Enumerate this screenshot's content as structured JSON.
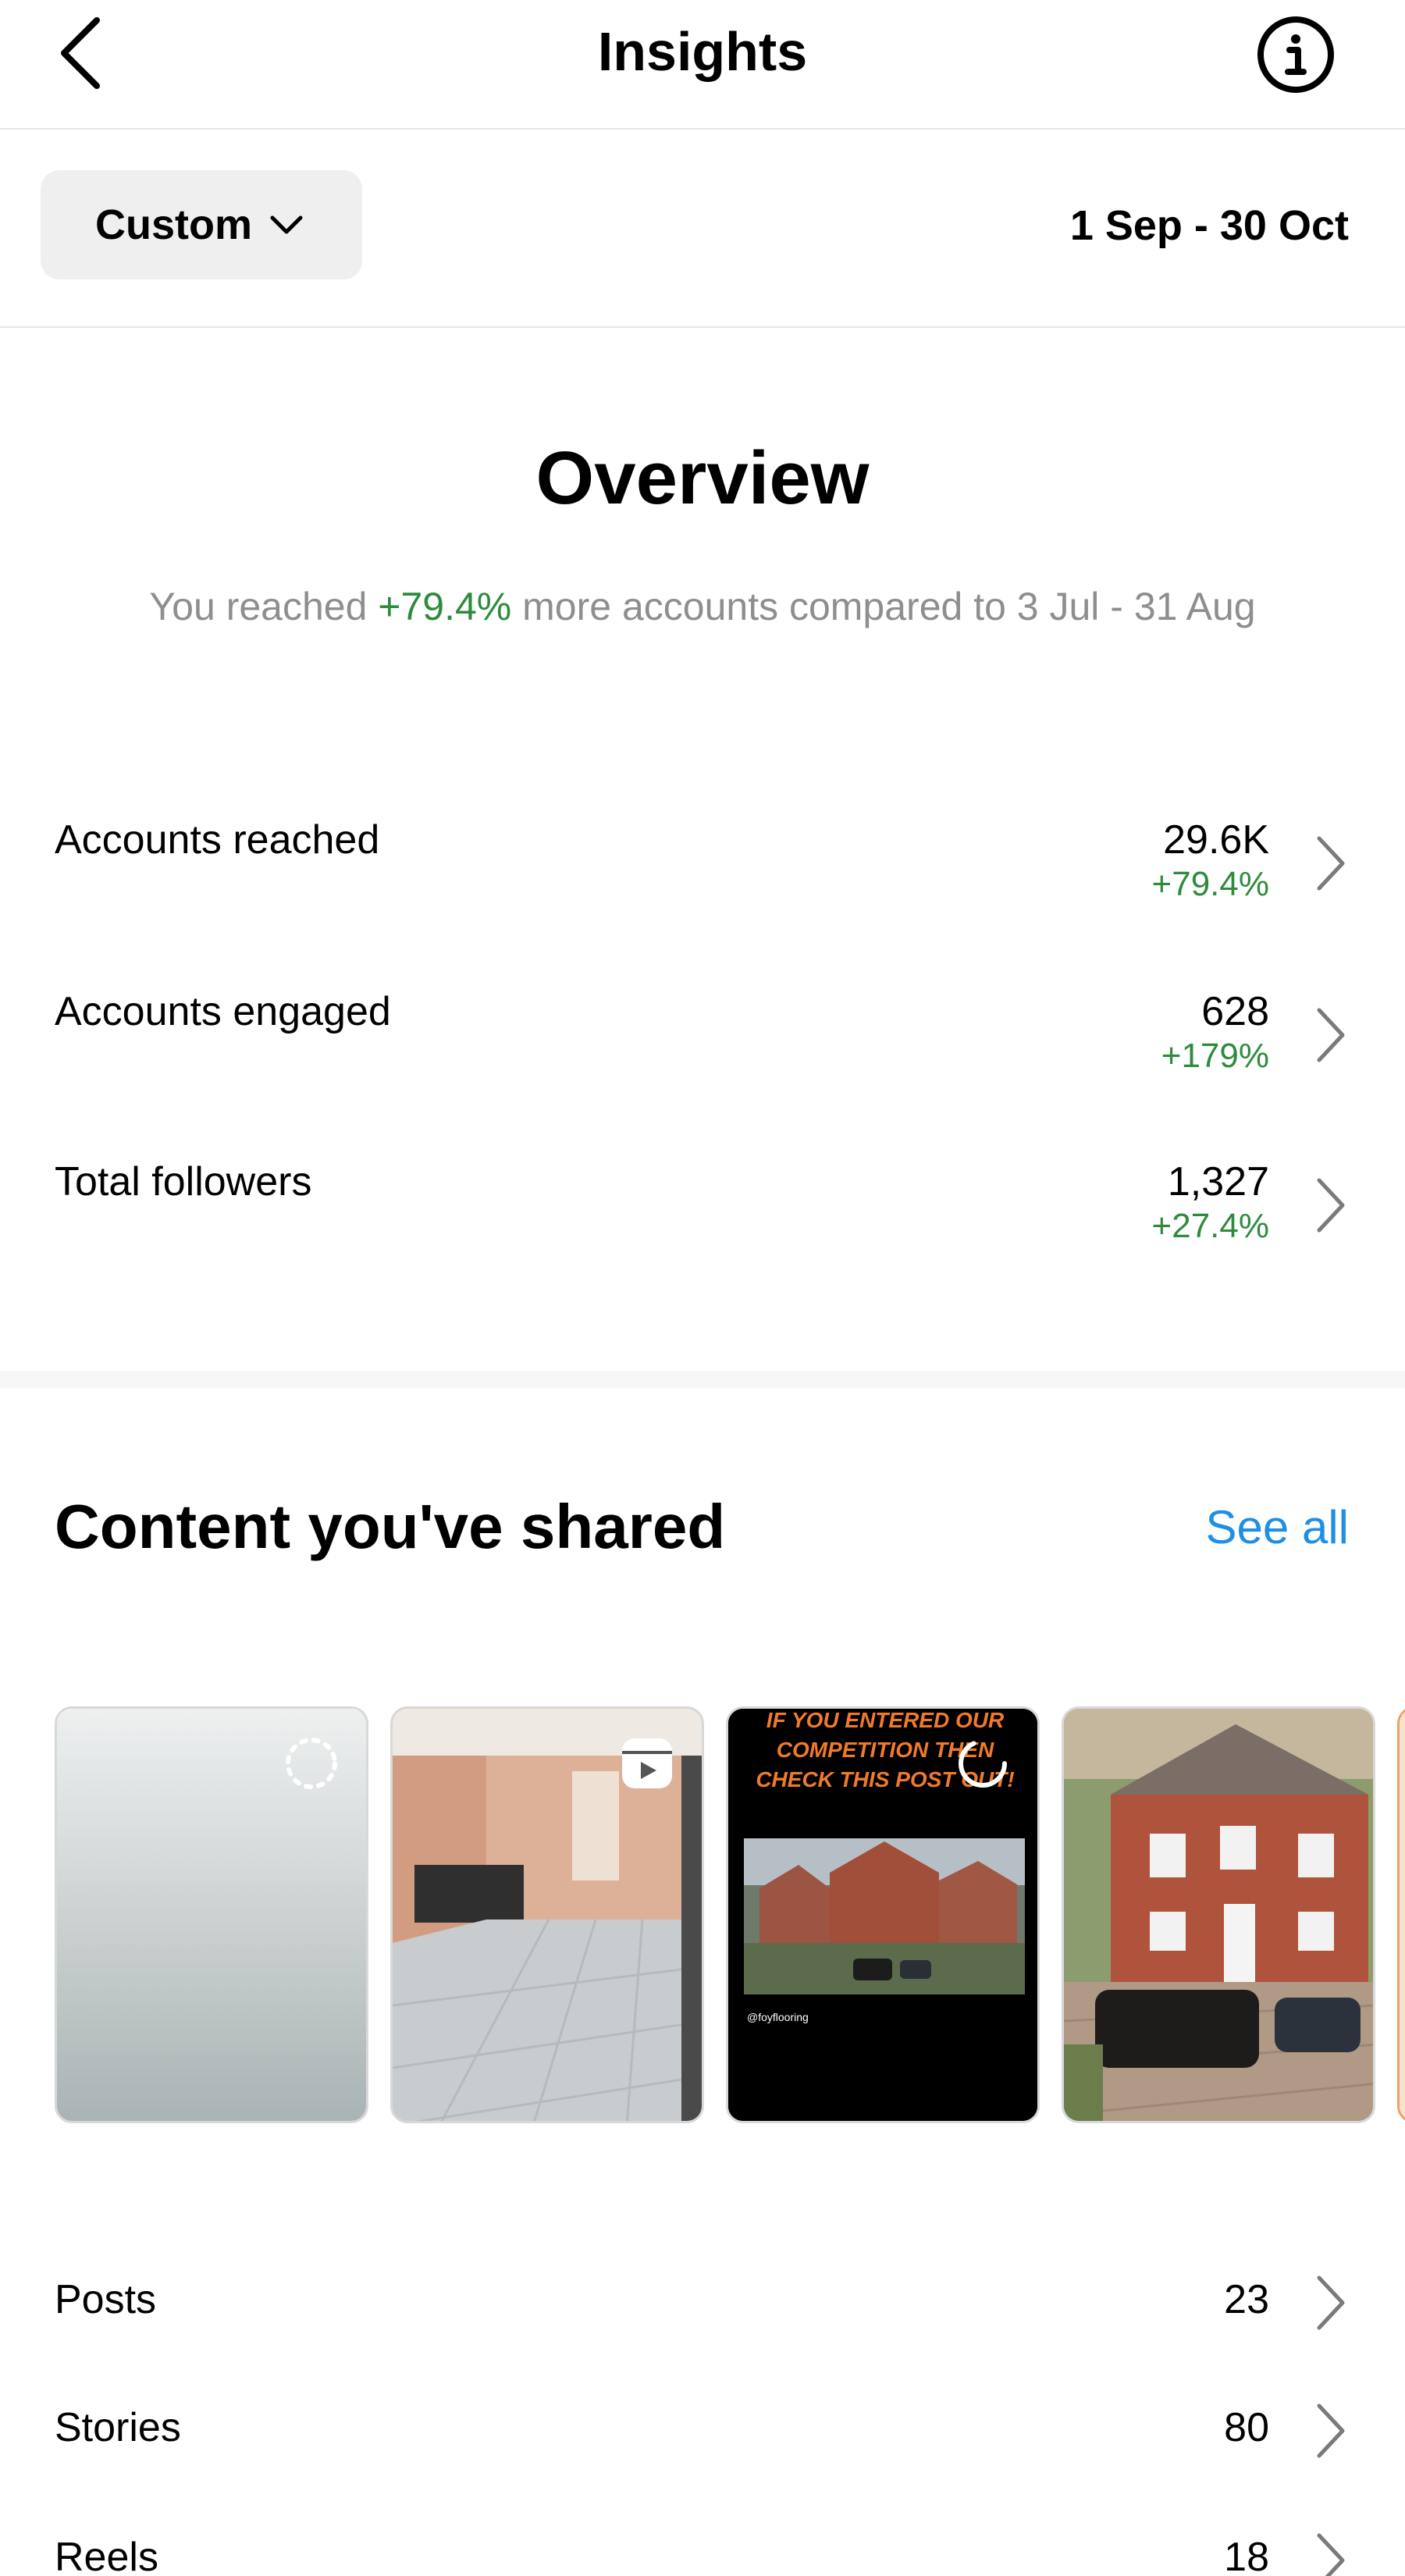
{
  "header": {
    "title": "Insights",
    "back_icon": "chevron-left-icon",
    "info_icon": "info-circle-icon"
  },
  "filter": {
    "range_type": "Custom",
    "date_range": "1 Sep - 30 Oct"
  },
  "overview": {
    "title": "Overview",
    "desc_prefix": "You reached ",
    "desc_highlight": "+79.4%",
    "desc_suffix": " more accounts compared to 3 Jul - 31 Aug",
    "metrics": [
      {
        "label": "Accounts reached",
        "value": "29.6K",
        "change": "+79.4%"
      },
      {
        "label": "Accounts engaged",
        "value": "628",
        "change": "+179%"
      },
      {
        "label": "Total followers",
        "value": "1,327",
        "change": "+27.4%"
      }
    ]
  },
  "content": {
    "title": "Content you've shared",
    "see_all": "See all",
    "thumbnails": [
      {
        "kind": "story-loading",
        "badge": "loading-spinner-icon"
      },
      {
        "kind": "reel-room-interior",
        "badge": "reels-icon"
      },
      {
        "kind": "competition-story",
        "badge": "loading-spinner-icon",
        "headline_lines": [
          "IF YOU ENTERED OUR",
          "COMPETITION THEN",
          "CHECK THIS POST OUT!"
        ],
        "handle": "@foyflooring"
      },
      {
        "kind": "post-house-vans"
      }
    ],
    "counts": [
      {
        "label": "Posts",
        "value": "23"
      },
      {
        "label": "Stories",
        "value": "80"
      },
      {
        "label": "Reels",
        "value": "18"
      }
    ]
  },
  "colors": {
    "positive": "#2e8b3d",
    "link": "#1f8fe5",
    "muted": "#8e8e8e",
    "button_bg": "#efefef"
  }
}
